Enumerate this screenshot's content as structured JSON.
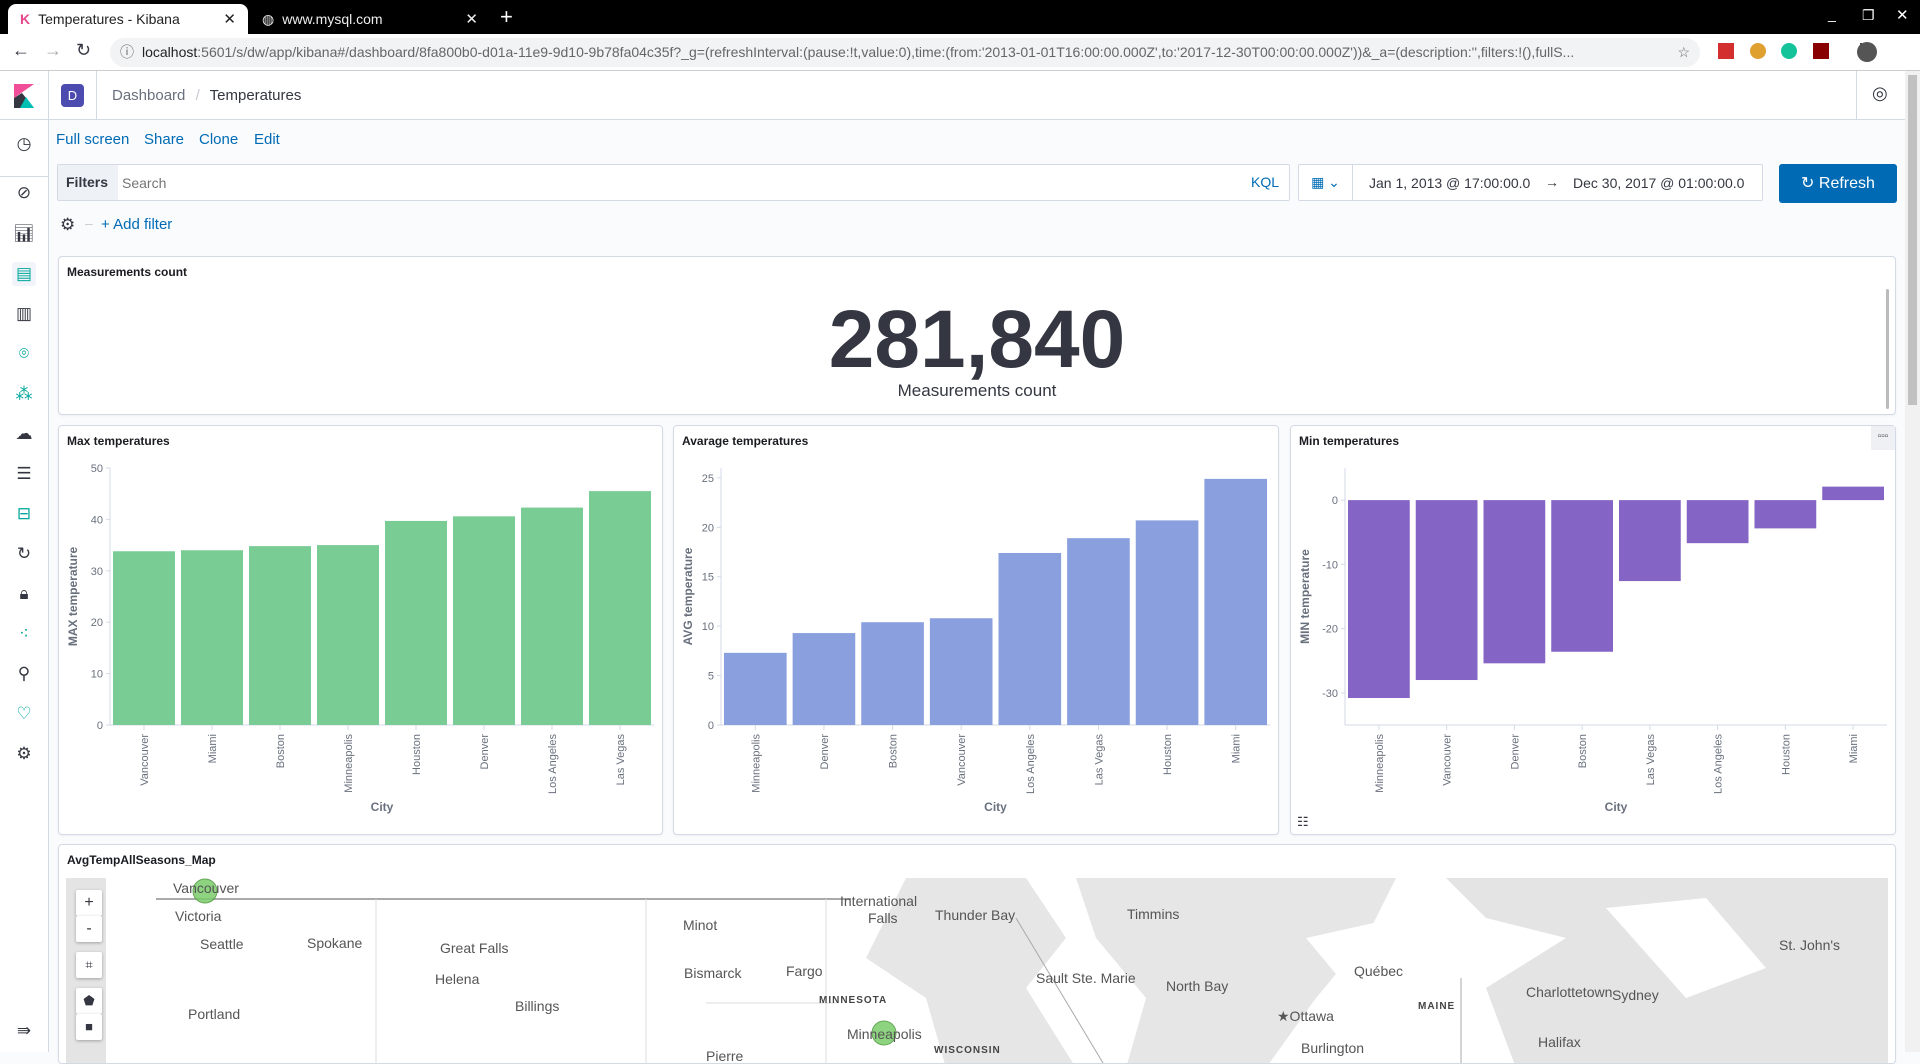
{
  "browser": {
    "tabs": [
      {
        "title": "Temperatures - Kibana",
        "active": true
      },
      {
        "title": "www.mysql.com",
        "active": false
      }
    ],
    "url_host": "localhost",
    "url_rest": ":5601/s/dw/app/kibana#/dashboard/8fa800b0-d01a-11e9-9d10-9b78fa04c35f?_g=(refreshInterval:(pause:!t,value:0),time:(from:'2013-01-01T16:00:00.000Z',to:'2017-12-30T00:00:00.000Z'))&_a=(description:'',filters:!(),fullS..."
  },
  "header": {
    "space_avatar": "D",
    "breadcrumbs": [
      "Dashboard",
      "Temperatures"
    ]
  },
  "toolbar": {
    "links": [
      "Full screen",
      "Share",
      "Clone",
      "Edit"
    ]
  },
  "query": {
    "filters_label": "Filters",
    "placeholder": "Search",
    "kql": "KQL",
    "time_from": "Jan 1, 2013 @ 17:00:00.0",
    "arrow": "→",
    "time_to": "Dec 30, 2017 @ 01:00:00.0",
    "refresh": "Refresh",
    "add_filter": "+ Add filter"
  },
  "metric": {
    "title": "Measurements count",
    "value": "281,840",
    "label": "Measurements count"
  },
  "colors": {
    "max": "#7acc95",
    "avg": "#8a9fde",
    "min": "#8464c4",
    "accent": "#006bb4"
  },
  "chart_data": [
    {
      "type": "bar",
      "title": "Max temperatures",
      "xlabel": "City",
      "ylabel": "MAX temperature",
      "ylim": [
        0,
        50
      ],
      "yticks": [
        0,
        10,
        20,
        30,
        40,
        50
      ],
      "categories": [
        "Vancouver",
        "Miami",
        "Boston",
        "Minneapolis",
        "Houston",
        "Denver",
        "Los Angeles",
        "Las Vegas"
      ],
      "values": [
        33.8,
        34,
        34.8,
        35,
        39.7,
        40.6,
        42.3,
        45.5
      ]
    },
    {
      "type": "bar",
      "title": "Avarage temperatures",
      "xlabel": "City",
      "ylabel": "AVG temperature",
      "ylim": [
        0,
        26
      ],
      "yticks": [
        0,
        5,
        10,
        15,
        20,
        25
      ],
      "categories": [
        "Minneapolis",
        "Denver",
        "Boston",
        "Vancouver",
        "Los Angeles",
        "Las Vegas",
        "Houston",
        "Miami"
      ],
      "values": [
        7.3,
        9.3,
        10.4,
        10.8,
        17.4,
        18.9,
        20.7,
        24.9
      ]
    },
    {
      "type": "bar",
      "title": "Min temperatures",
      "xlabel": "City",
      "ylabel": "MIN temperature",
      "ylim": [
        -35,
        5
      ],
      "yticks": [
        -30,
        -20,
        -10,
        0
      ],
      "categories": [
        "Minneapolis",
        "Vancouver",
        "Denver",
        "Boston",
        "Las Vegas",
        "Los Angeles",
        "Houston",
        "Miami"
      ],
      "values": [
        -30.8,
        -28,
        -25.4,
        -23.6,
        -12.6,
        -6.7,
        -4.4,
        2.1
      ]
    }
  ],
  "map": {
    "title": "AvgTempAllSeasons_Map",
    "zoom_in": "+",
    "zoom_out": "-",
    "labels": [
      "Vancouver",
      "Victoria",
      "Seattle",
      "Spokane",
      "Great Falls",
      "Helena",
      "Billings",
      "Portland",
      "Minot",
      "Bismarck",
      "Fargo",
      "MINNESOTA",
      "Minneapolis",
      "International",
      "Falls",
      "Thunder Bay",
      "Timmins",
      "Sault Ste. Marie",
      "North Bay",
      "★Ottawa",
      "Québec",
      "MAINE",
      "Charlottetown",
      "Sydney",
      "St. John's",
      "Halifax",
      "Burlington",
      "WISCONSIN",
      "Pierre"
    ]
  }
}
